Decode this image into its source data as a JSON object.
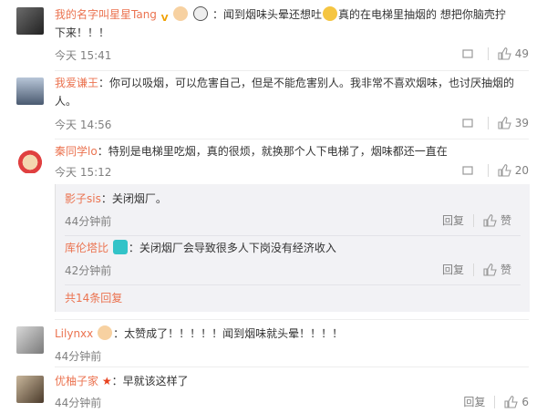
{
  "comments": [
    {
      "user": "我的名字叫星星Tang",
      "badges": [
        "V",
        "🏆",
        "🐼"
      ],
      "text_lines": [
        "：闻到烟味头晕还想吐",
        "真的在电梯里抽烟的 想把你脑壳拧",
        "下来！！！"
      ],
      "time": "今天 15:41",
      "likes": "49"
    },
    {
      "user": "我爱谦王",
      "text_lines": [
        "：你可以吸烟，可以危害自己，但是不能危害别人。我非常不喜欢烟味，也讨厌抽烟的",
        "人。"
      ],
      "time": "今天 14:56",
      "likes": "39"
    },
    {
      "user": "秦同学lo",
      "text": "：特别是电梯里吃烟，真的很烦，就换那个人下电梯了，烟味都还一直在",
      "time": "今天 15:12",
      "likes": "20",
      "replies": [
        {
          "user": "影子sis",
          "text": "：关闭烟厂。",
          "time": "44分钟前",
          "reply_label": "回复",
          "like_label": "赞"
        },
        {
          "user": "库伦塔比",
          "text": "：关闭烟厂会导致很多人下岗没有经济收入",
          "time": "42分钟前",
          "reply_label": "回复",
          "like_label": "赞"
        }
      ],
      "more_replies": "共14条回复"
    },
    {
      "user": "Lilynxx",
      "text": "：太赞成了！！！！！闻到烟味就头晕！！！！",
      "time": "44分钟前",
      "likes": ""
    },
    {
      "user": "优柚子家",
      "text": "：早就该这样了",
      "time": "44分钟前",
      "likes": "6"
    }
  ],
  "labels": {
    "reply": "回复",
    "like": "赞"
  },
  "colors": {
    "username": "#eb7350",
    "meta": "#808080",
    "subbox_bg": "#f2f2f5"
  }
}
